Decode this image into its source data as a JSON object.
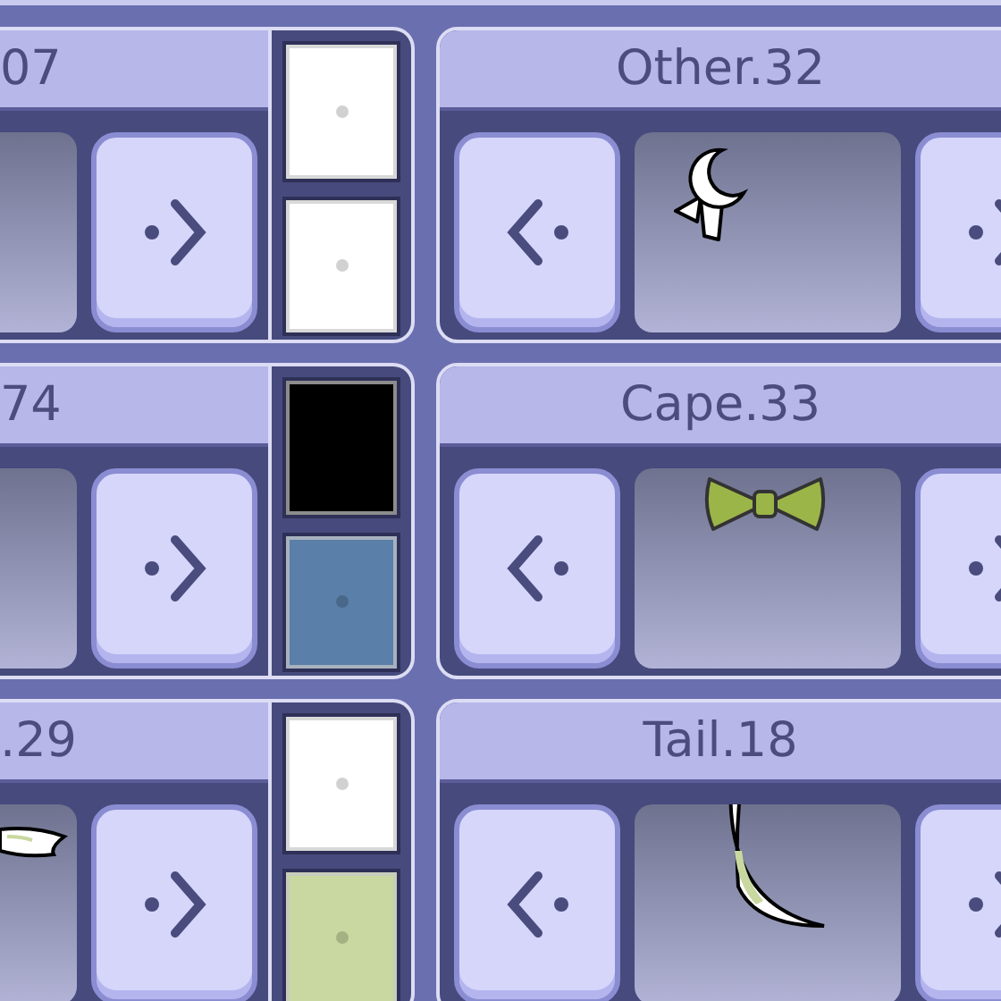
{
  "rows": [
    {
      "left": {
        "title": "07",
        "kind": "none",
        "swatches": [
          {
            "color": "#ffffff"
          },
          {
            "color": "#ffffff"
          }
        ]
      },
      "right": {
        "title": "Other.32",
        "kind": "charm"
      }
    },
    {
      "left": {
        "title": "74",
        "kind": "none",
        "swatches": [
          {
            "color": "#000000"
          },
          {
            "color": "#5a7fa8"
          }
        ]
      },
      "right": {
        "title": "Cape.33",
        "kind": "bow"
      }
    },
    {
      "left": {
        "title": ".29",
        "kind": "wing",
        "swatches": [
          {
            "color": "#ffffff"
          },
          {
            "color": "#c9d8a0"
          }
        ]
      },
      "right": {
        "title": "Tail.18",
        "kind": "tail"
      }
    }
  ]
}
